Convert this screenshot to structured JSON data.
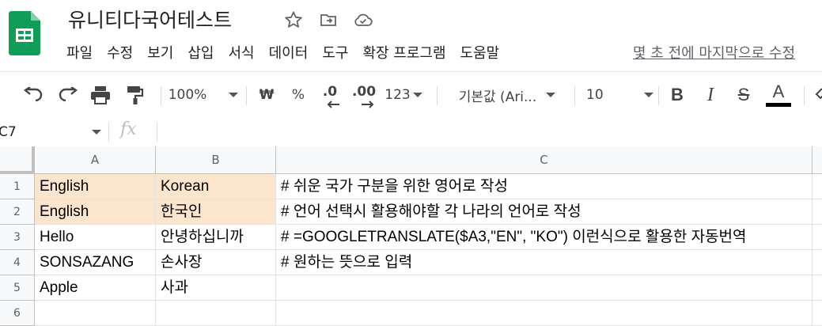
{
  "doc": {
    "title": "유니티다국어테스트"
  },
  "menu": [
    "파일",
    "수정",
    "보기",
    "삽입",
    "서식",
    "데이터",
    "도구",
    "확장 프로그램",
    "도움말"
  ],
  "last_edit": "몇 초 전에 마지막으로 수정",
  "toolbar": {
    "zoom": "100%",
    "currency": "₩",
    "percent": "%",
    "dec_decrease": ".0",
    "dec_increase": ".00",
    "number_format": "123",
    "font": "기본값 (Ari...",
    "font_size": "10",
    "bold": "B",
    "italic": "I",
    "strike": "S",
    "text_color": "A"
  },
  "namebox": "C7",
  "fx": "fx",
  "columns": [
    "A",
    "B",
    "C"
  ],
  "rows": [
    "1",
    "2",
    "3",
    "4",
    "5",
    "6"
  ],
  "cells": [
    [
      "English",
      "Korean",
      "# 쉬운 국가 구분을 위한 영어로 작성"
    ],
    [
      "English",
      "한국인",
      "# 언어 선택시 활용해야할 각 나라의 언어로 작성"
    ],
    [
      "Hello",
      "안녕하십니까",
      "# =GOOGLETRANSLATE($A3,\"EN\", \"KO\") 이런식으로 활용한 자동번역"
    ],
    [
      "SONSAZANG",
      "손사장",
      "# 원하는 뜻으로 입력"
    ],
    [
      "Apple",
      "사과",
      ""
    ],
    [
      "",
      "",
      ""
    ]
  ],
  "colors": {
    "header_highlight": "#fce5cd",
    "sheets_green": "#0f9d58"
  }
}
